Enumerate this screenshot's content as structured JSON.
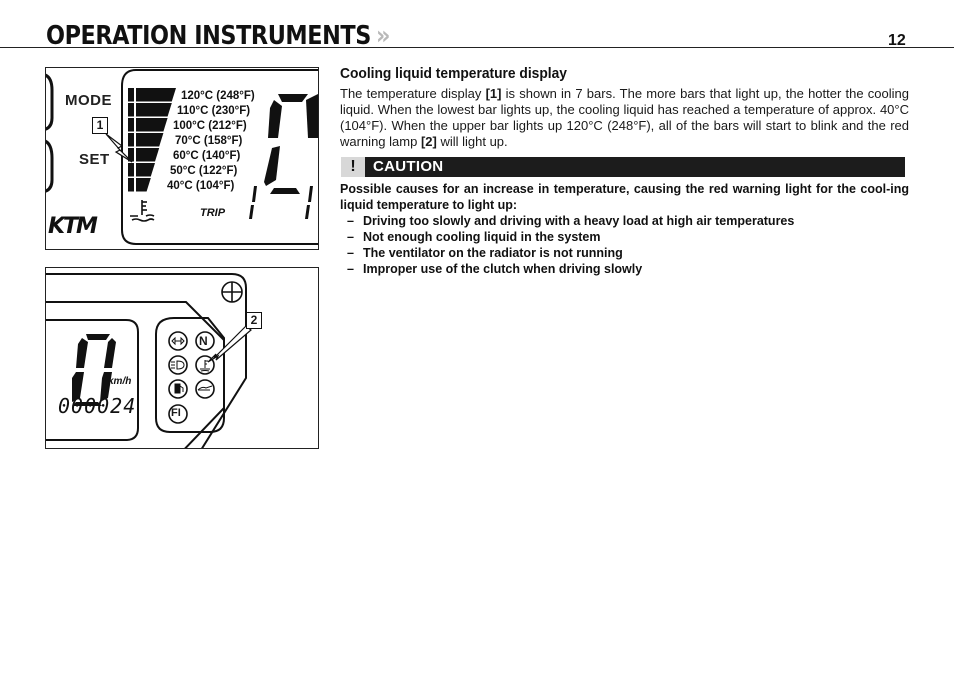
{
  "header": {
    "title": "OPERATION INSTRUMENTS",
    "chevron": "»",
    "page_number": "12"
  },
  "figure1": {
    "mode_label": "MODE",
    "set_label": "SET",
    "callout": "1",
    "brand": "KTM",
    "trip_label": "TRIP",
    "temperature_bars": [
      {
        "celsius": "120°C",
        "fahrenheit": "(248°F)"
      },
      {
        "celsius": "110°C",
        "fahrenheit": "(230°F)"
      },
      {
        "celsius": "100°C",
        "fahrenheit": "(212°F)"
      },
      {
        "celsius": "70°C",
        "fahrenheit": "(158°F)"
      },
      {
        "celsius": "60°C",
        "fahrenheit": "(140°F)"
      },
      {
        "celsius": "50°C",
        "fahrenheit": "(122°F)"
      },
      {
        "celsius": "40°C",
        "fahrenheit": "(104°F)"
      }
    ],
    "labels": {
      "t0": "120°C  (248°F)",
      "t1": "110°C  (230°F)",
      "t2": "100°C  (212°F)",
      "t3": "70°C  (158°F)",
      "t4": "60°C  (140°F)",
      "t5": "50°C  (122°F)",
      "t6": "40°C  (104°F)"
    }
  },
  "figure2": {
    "callout": "2",
    "speed": "0",
    "speed_unit": "km/h",
    "odometer": "000024",
    "indicator_lamps": [
      "turn-signal",
      "neutral",
      "high-beam",
      "coolant-temperature",
      "fuel",
      "oil-pressure",
      "fuel-injection"
    ],
    "neutral_label": "N",
    "fi_label": "FI"
  },
  "section": {
    "heading": "Cooling liquid temperature display",
    "body_parts": {
      "p1": "The temperature display ",
      "ref1": "[1]",
      "p2": " is shown in 7 bars. The more bars that light up, the hotter the cooling liquid. When the lowest bar lights up, the cooling liquid has reached a temperature of approx. 40°C (104°F). When the upper bar lights up 120°C (248°F), all of the bars will start to blink and the red warning lamp ",
      "ref2": "[2]",
      "p3": " will light up."
    }
  },
  "caution": {
    "icon": "!",
    "title": "CAUTION",
    "intro": "Possible causes for an increase in temperature, causing the red warning light for the cool-ing liquid temperature to light up:",
    "items": [
      "Driving too slowly and driving with a heavy load at high air temperatures",
      "Not enough cooling liquid in the system",
      "The ventilator on the radiator is not running",
      "Improper use of the clutch when driving slowly"
    ],
    "bullet": "–"
  }
}
